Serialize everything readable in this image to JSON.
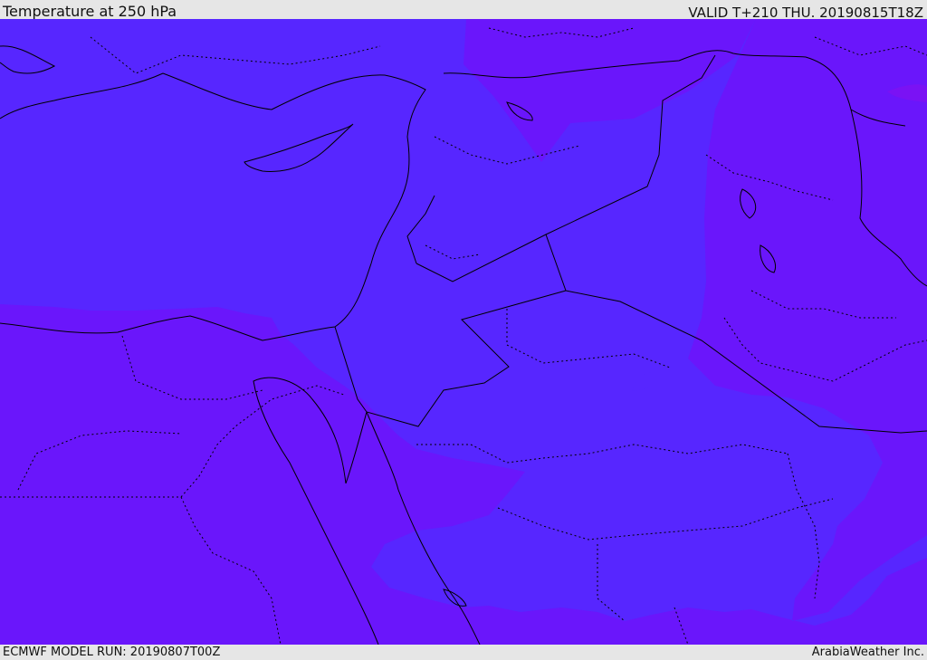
{
  "header": {
    "title": "Temperature at 250 hPa",
    "valid": "VALID T+210 THU. 20190815T18Z"
  },
  "footer": {
    "model_run": "ECMWF MODEL RUN: 20190807T00Z",
    "credit": "ArabiaWeather Inc."
  },
  "map": {
    "colors": {
      "warm_band": "#6a16fb",
      "cool_band": "#5726ff",
      "hot_spot": "#7a12f4",
      "boundary": "#000000"
    }
  }
}
